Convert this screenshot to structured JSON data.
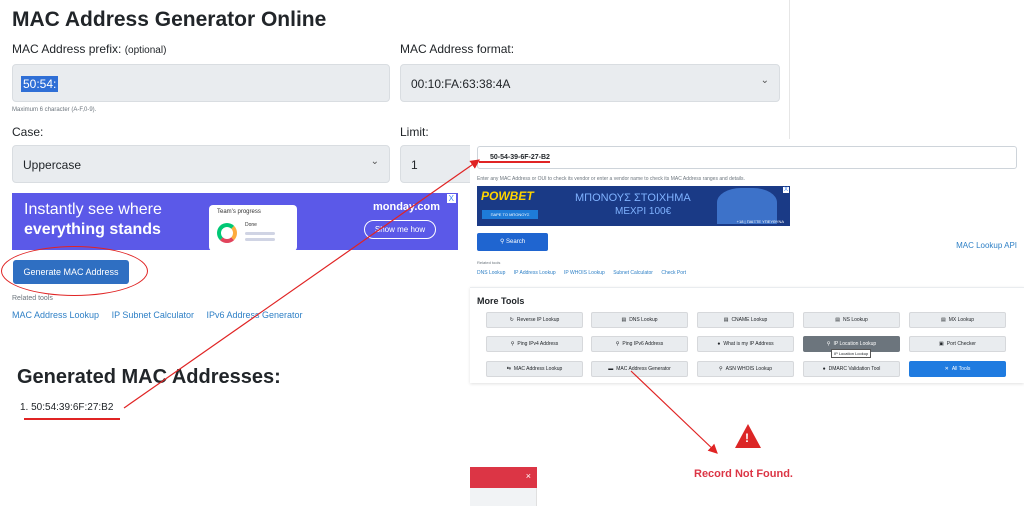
{
  "generator": {
    "title": "MAC Address Generator Online",
    "prefix_label": "MAC Address prefix:",
    "prefix_optional": "(optional)",
    "prefix_value": "50:54:",
    "prefix_hint": "Maximum 6 character (A-F,0-9).",
    "format_label": "MAC Address format:",
    "format_value": "00:10:FA:63:38:4A",
    "case_label": "Case:",
    "case_value": "Uppercase",
    "limit_label": "Limit:",
    "limit_value": "1",
    "generate_button": "Generate MAC Address",
    "related_label": "Related tools",
    "related_links": [
      "MAC Address Lookup",
      "IP Subnet Calculator",
      "IPv6 Address Generator"
    ]
  },
  "ad_monday": {
    "line1": "Instantly see where",
    "line2": "everything stands",
    "card_title": "Team's progress",
    "card_item": "Done",
    "brand": "monday.com",
    "cta": "Show me how",
    "close": "X"
  },
  "results": {
    "title": "Generated MAC Addresses:",
    "items": [
      "1.  50:54:39:6F:27:B2"
    ]
  },
  "lookup": {
    "input_value": "50-54-39-6F-27-B2",
    "hint": "Enter any MAC Address or OUI to check its vendor or enter a vendor name to check its MAC Address ranges and details.",
    "search_button": "Search",
    "api_link": "MAC Lookup API",
    "related_label": "Related tools",
    "related_links": [
      "DNS Lookup",
      "IP Address Lookup",
      "IP WHOIS Lookup",
      "Subnet Calculator",
      "Check Port"
    ]
  },
  "ad_bet": {
    "logo": "POWBET",
    "button": "ΠΑΡΕ ΤΟ ΜΠΟΝΟΥΣ",
    "text1": "ΜΠΟΝΟΥΣ ΣΤΟΙΧΗΜΑ",
    "text2": "ΜΕΧΡΙ 100€",
    "footer": "+18 | ΠΑΙΞΤΕ ΥΠΕΥΘΥΝΑ",
    "close": "X"
  },
  "more_tools": {
    "title": "More Tools",
    "rows": [
      [
        "Reverse IP Lookup",
        "DNS Lookup",
        "CNAME Lookup",
        "NS Lookup",
        "MX Lookup"
      ],
      [
        "Ping IPv4 Address",
        "Ping IPv6 Address",
        "What is my IP Address",
        "IP Location Lookup",
        "Port Checker"
      ],
      [
        "MAC Address Lookup",
        "MAC Address Generator",
        "ASN WHOIS Lookup",
        "DMARC Validation Tool",
        "All Tools"
      ]
    ],
    "icons": [
      [
        "↻",
        "▤",
        "▤",
        "▤",
        "▤"
      ],
      [
        "⚲",
        "⚲",
        "●",
        "⚲",
        "▣"
      ],
      [
        "⇆",
        "▬",
        "⚲",
        "●",
        "✕"
      ]
    ],
    "tooltip": "IP Location Lookup"
  },
  "status": {
    "warning_symbol": "!",
    "message": "Record Not Found.",
    "alert_close": "×"
  },
  "colors": {
    "annotation": "#e02424",
    "link": "#2f80c6",
    "primary": "#1f65d0",
    "danger": "#dc3545"
  }
}
